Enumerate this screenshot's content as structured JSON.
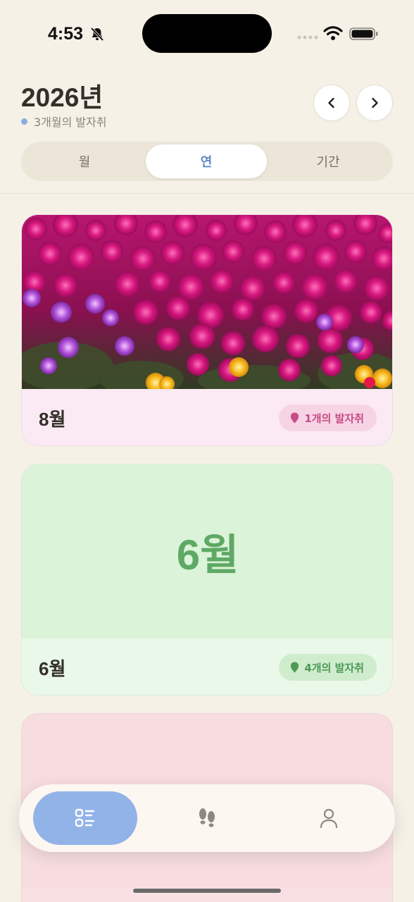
{
  "status_bar": {
    "time": "4:53",
    "icons": [
      "bell-slash-icon",
      "cellular-signal-icon",
      "wifi-icon",
      "battery-icon"
    ]
  },
  "header": {
    "year_title": "2026년",
    "subtitle": "3개월의 발자취",
    "prev_icon": "chevron-left-icon",
    "next_icon": "chevron-right-icon"
  },
  "segmented": {
    "items": [
      "월",
      "연",
      "기간"
    ],
    "selected": "연"
  },
  "cards": [
    {
      "month": "8월",
      "count_label": "1개의 발자취",
      "cover": "photo-magenta-flowers",
      "accent": "#c74b86"
    },
    {
      "month": "6월",
      "cover_label": "6월",
      "count_label": "4개의 발자취",
      "accent": "#4d9a55"
    },
    {
      "accent": "#c45a64"
    }
  ],
  "tab_bar": {
    "tabs": [
      "list-icon",
      "footprints-icon",
      "person-icon"
    ],
    "active_color": "#92b3e8"
  },
  "colors": {
    "background": "#f6f1e7",
    "accent_blue": "#5f88c5"
  }
}
